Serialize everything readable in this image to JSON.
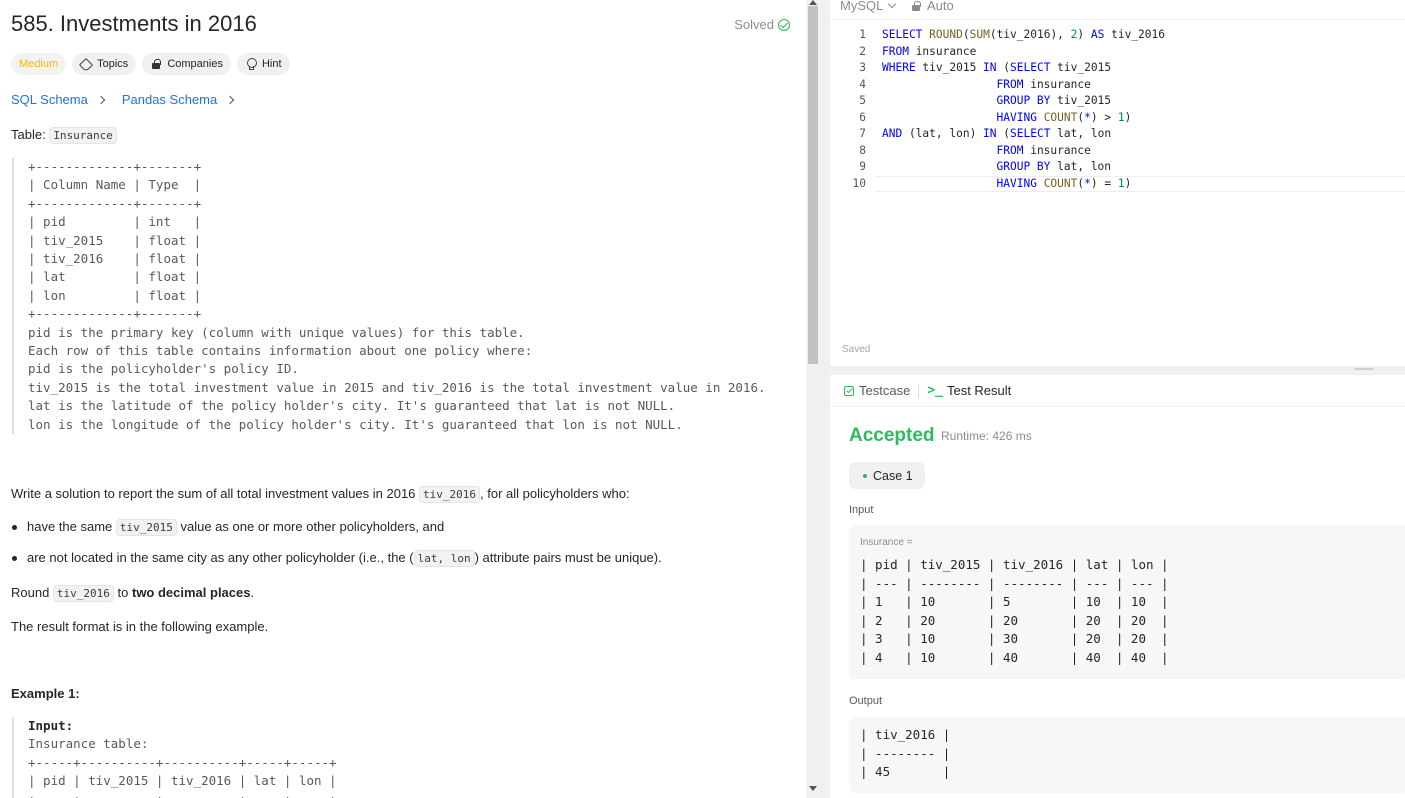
{
  "problem": {
    "title": "585. Investments in 2016",
    "status": "Solved",
    "tags": {
      "difficulty": "Medium",
      "topics": "Topics",
      "companies": "Companies",
      "hint": "Hint"
    },
    "schemas": [
      "SQL Schema",
      "Pandas Schema"
    ],
    "table_label": "Table: ",
    "table_name": "Insurance",
    "schema_block": "+-------------+-------+\n| Column Name | Type  |\n+-------------+-------+\n| pid         | int   |\n| tiv_2015    | float |\n| tiv_2016    | float |\n| lat         | float |\n| lon         | float |\n+-------------+-------+\npid is the primary key (column with unique values) for this table.\nEach row of this table contains information about one policy where:\npid is the policyholder's policy ID.\ntiv_2015 is the total investment value in 2015 and tiv_2016 is the total investment value in 2016.\nlat is the latitude of the policy holder's city. It's guaranteed that lat is not NULL.\nlon is the longitude of the policy holder's city. It's guaranteed that lon is not NULL.",
    "write_prefix": "Write a solution to report the sum of all total investment values in 2016 ",
    "write_code": "tiv_2016",
    "write_suffix": ", for all policyholders who:",
    "bullet1_prefix": "have the same ",
    "bullet1_code": "tiv_2015",
    "bullet1_suffix": " value as one or more other policyholders, and",
    "bullet2_prefix": "are not located in the same city as any other policyholder (i.e., the (",
    "bullet2_code": "lat, lon",
    "bullet2_suffix": ") attribute pairs must be unique).",
    "round_prefix": "Round ",
    "round_code": "tiv_2016",
    "round_mid": " to ",
    "round_bold": "two decimal places",
    "round_suffix": ".",
    "format_note": "The result format is in the following example.",
    "example_title": "Example 1:",
    "example_input_label": "Input:",
    "example_block": "Insurance table:\n+-----+----------+----------+-----+-----+\n| pid | tiv_2015 | tiv_2016 | lat | lon |\n+-----+----------+----------+-----+-----+"
  },
  "editor": {
    "language": "MySQL",
    "mode": "Auto",
    "saved": "Saved",
    "lines": [
      "1",
      "2",
      "3",
      "4",
      "5",
      "6",
      "7",
      "8",
      "9",
      "10"
    ]
  },
  "results": {
    "tab_testcase": "Testcase",
    "tab_result": "Test Result",
    "verdict": "Accepted",
    "runtime": "Runtime: 426 ms",
    "case": "Case 1",
    "input_label": "Input",
    "input_sub": "Insurance =",
    "input_table": "| pid | tiv_2015 | tiv_2016 | lat | lon |\n| --- | -------- | -------- | --- | --- |\n| 1   | 10       | 5        | 10  | 10  |\n| 2   | 20       | 20       | 20  | 20  |\n| 3   | 10       | 30       | 20  | 20  |\n| 4   | 10       | 40       | 40  | 40  |",
    "output_label": "Output",
    "output_table": "| tiv_2016 |\n| -------- |\n| 45       |"
  },
  "colors": {
    "accent_green": "#2cbb5d",
    "medium": "#ffb800",
    "link": "#1a73e8",
    "keyword": "#0000ff",
    "number": "#098658"
  }
}
